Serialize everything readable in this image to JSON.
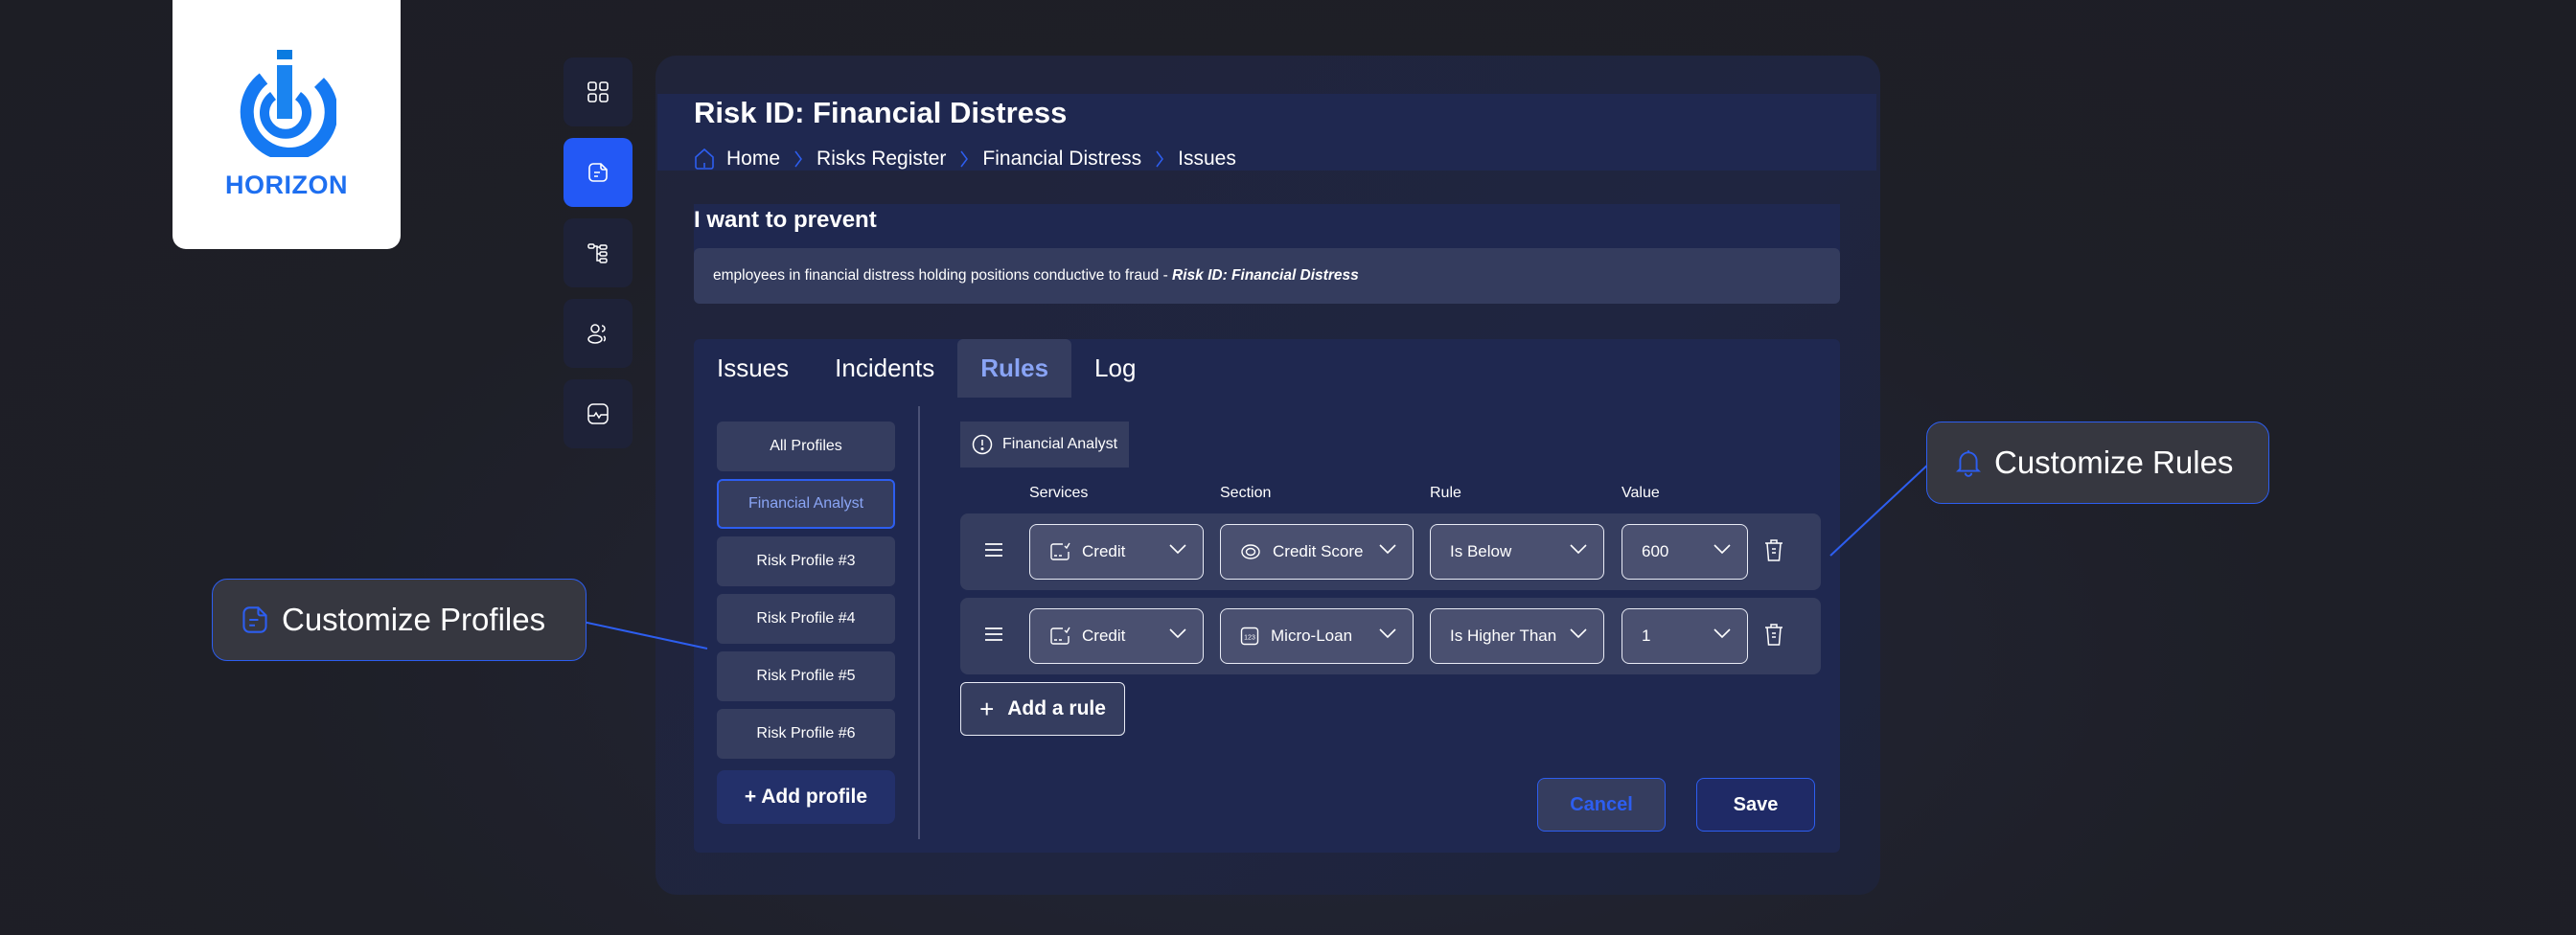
{
  "brand": {
    "name": "HORIZON",
    "color": "#1e6ff0"
  },
  "rail": {
    "items": [
      {
        "icon": "grid-icon",
        "active": false
      },
      {
        "icon": "document-icon",
        "active": true
      },
      {
        "icon": "hierarchy-icon",
        "active": false
      },
      {
        "icon": "users-icon",
        "active": false
      },
      {
        "icon": "activity-monitor-icon",
        "active": false
      }
    ]
  },
  "header": {
    "title": "Risk ID: Financial Distress",
    "breadcrumb": [
      "Home",
      "Risks Register",
      "Financial Distress",
      "Issues"
    ]
  },
  "prevent": {
    "title": "I want to prevent",
    "text": "employees in financial distress holding positions conductive to fraud - ",
    "emphasis": "Risk ID: Financial Distress"
  },
  "tabs": [
    {
      "label": "Issues",
      "active": false
    },
    {
      "label": "Incidents",
      "active": false
    },
    {
      "label": "Rules",
      "active": true
    },
    {
      "label": "Log",
      "active": false
    }
  ],
  "profiles": {
    "items": [
      "All Profiles",
      "Financial Analyst",
      "Risk Profile #3",
      "Risk Profile #4",
      "Risk Profile #5",
      "Risk Profile #6"
    ],
    "selected": "Financial Analyst",
    "add_label": "+ Add profile"
  },
  "rules": {
    "profile_chip": "Financial Analyst",
    "columns": [
      "Services",
      "Section",
      "Rule",
      "Value"
    ],
    "rows": [
      {
        "service": "Credit",
        "section": "Credit Score",
        "section_icon": "eye-icon",
        "rule": "Is Below",
        "value": "600"
      },
      {
        "service": "Credit",
        "section": "Micro-Loan",
        "section_icon": "numbers-123-icon",
        "rule": "Is Higher Than",
        "value": "1"
      }
    ],
    "add_label": "Add a rule"
  },
  "actions": {
    "cancel": "Cancel",
    "save": "Save"
  },
  "callouts": {
    "profiles": "Customize Profiles",
    "rules": "Customize Rules"
  },
  "colors": {
    "accent": "#2d5ef0",
    "active_rail": "#2358f5",
    "tab_active_text": "#89a4f5"
  }
}
